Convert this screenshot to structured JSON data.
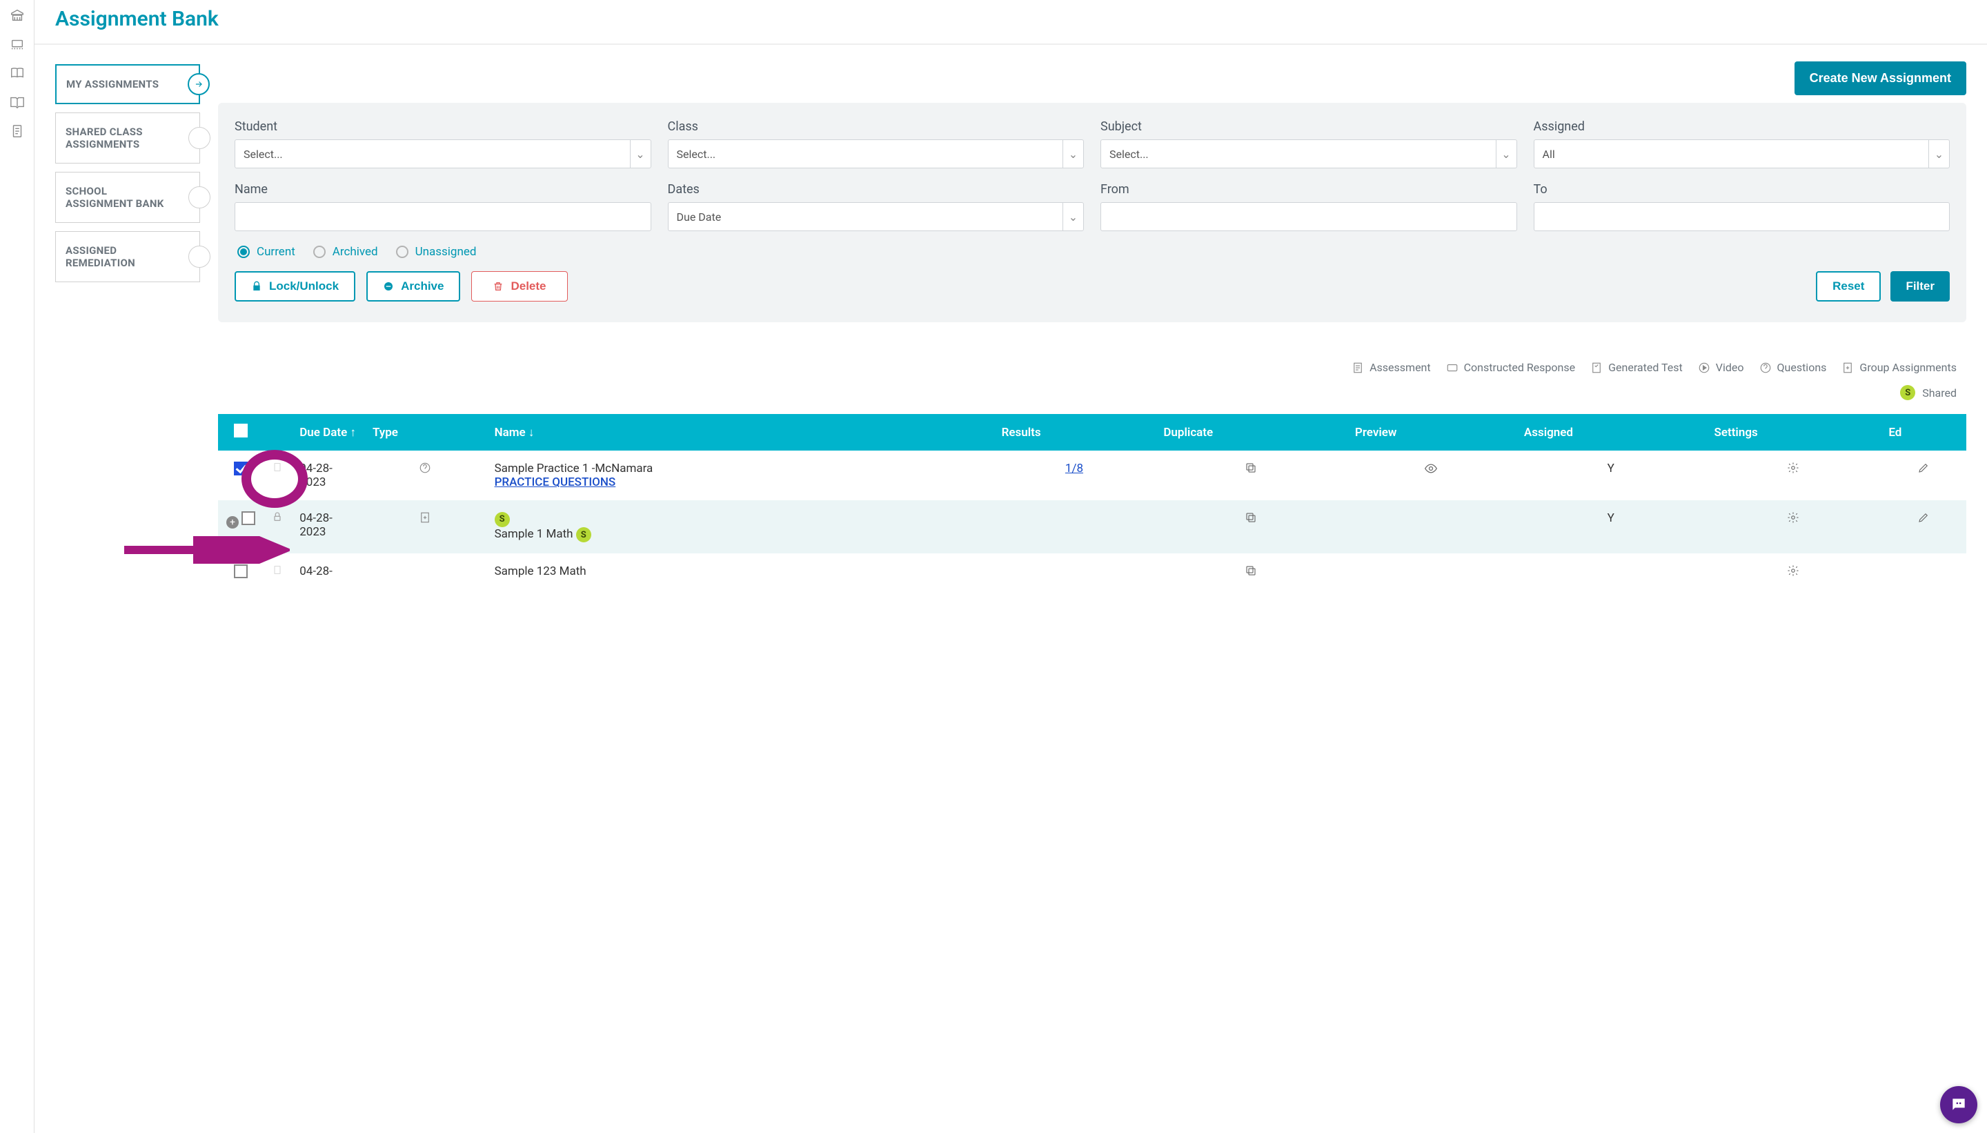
{
  "page_title": "Assignment Bank",
  "left_nav": {
    "items": [
      {
        "label": "MY ASSIGNMENTS",
        "active": true
      },
      {
        "label": "SHARED CLASS ASSIGNMENTS",
        "active": false
      },
      {
        "label": "SCHOOL ASSIGNMENT BANK",
        "active": false
      },
      {
        "label": "ASSIGNED REMEDIATION",
        "active": false
      }
    ]
  },
  "create_button": "Create New Assignment",
  "filters": {
    "student_label": "Student",
    "student_value": "Select...",
    "class_label": "Class",
    "class_value": "Select...",
    "subject_label": "Subject",
    "subject_value": "Select...",
    "assigned_label": "Assigned",
    "assigned_value": "All",
    "name_label": "Name",
    "name_value": "",
    "dates_label": "Dates",
    "dates_value": "Due Date",
    "from_label": "From",
    "from_value": "",
    "to_label": "To",
    "to_value": ""
  },
  "radios": {
    "current": "Current",
    "archived": "Archived",
    "unassigned": "Unassigned",
    "selected": "current"
  },
  "actions": {
    "lock_unlock": "Lock/Unlock",
    "archive": "Archive",
    "delete": "Delete",
    "reset": "Reset",
    "filter": "Filter"
  },
  "legend": {
    "assessment": "Assessment",
    "constructed_response": "Constructed Response",
    "generated_test": "Generated Test",
    "video": "Video",
    "questions": "Questions",
    "group_assignments": "Group Assignments",
    "shared": "Shared",
    "shared_badge": "S"
  },
  "table": {
    "headers": {
      "due_date": "Due Date",
      "type": "Type",
      "name": "Name",
      "results": "Results",
      "duplicate": "Duplicate",
      "preview": "Preview",
      "assigned": "Assigned",
      "settings": "Settings",
      "edit": "Ed"
    },
    "rows": [
      {
        "checked": true,
        "expandable": false,
        "due_date": "04-28-2023",
        "type_icon": "question",
        "name": "Sample Practice 1 -McNamara",
        "name_sub": "PRACTICE QUESTIONS",
        "shared_badge": false,
        "results": "1/8",
        "assigned": "Y",
        "has_preview": true,
        "has_edit": true
      },
      {
        "checked": false,
        "expandable": true,
        "locked": true,
        "due_date": "04-28-2023",
        "type_icon": "group",
        "name": "Sample 1 Math",
        "name_sub": "",
        "shared_badge": true,
        "shared_badge_pre": true,
        "results": "",
        "assigned": "Y",
        "has_preview": false,
        "has_edit": true
      },
      {
        "checked": false,
        "expandable": false,
        "due_date": "04-28-",
        "type_icon": "",
        "name": "Sample 123 Math",
        "name_sub": "",
        "shared_badge": false,
        "results": "",
        "assigned": "",
        "has_preview": false,
        "has_edit": false
      }
    ]
  }
}
